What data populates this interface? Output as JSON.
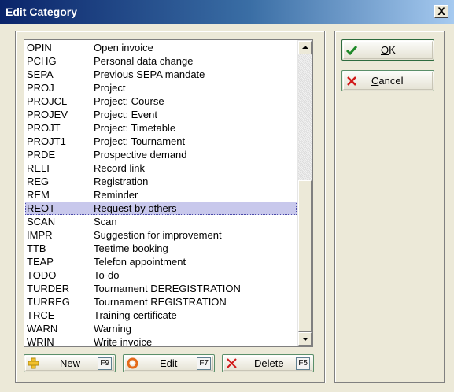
{
  "window": {
    "title": "Edit Category",
    "close_label": "X"
  },
  "list": {
    "selected_index": 12,
    "items": [
      {
        "code": "OPIN",
        "description": "Open invoice"
      },
      {
        "code": "PCHG",
        "description": "Personal data change"
      },
      {
        "code": "SEPA",
        "description": "Previous SEPA mandate"
      },
      {
        "code": "PROJ",
        "description": "Project"
      },
      {
        "code": "PROJCL",
        "description": "Project: Course"
      },
      {
        "code": "PROJEV",
        "description": "Project: Event"
      },
      {
        "code": "PROJT",
        "description": "Project: Timetable"
      },
      {
        "code": "PROJT1",
        "description": "Project: Tournament"
      },
      {
        "code": "PRDE",
        "description": "Prospective demand"
      },
      {
        "code": "RELI",
        "description": "Record link"
      },
      {
        "code": "REG",
        "description": "Registration"
      },
      {
        "code": "REM",
        "description": "Reminder"
      },
      {
        "code": "REOT",
        "description": "Request by others"
      },
      {
        "code": "SCAN",
        "description": "Scan"
      },
      {
        "code": "IMPR",
        "description": "Suggestion for improvement"
      },
      {
        "code": "TTB",
        "description": "Teetime booking"
      },
      {
        "code": "TEAP",
        "description": "Telefon appointment"
      },
      {
        "code": "TODO",
        "description": "To-do"
      },
      {
        "code": "TURDER",
        "description": "Tournament DEREGISTRATION"
      },
      {
        "code": "TURREG",
        "description": "Tournament REGISTRATION"
      },
      {
        "code": "TRCE",
        "description": "Training certificate"
      },
      {
        "code": "WARN",
        "description": "Warning"
      },
      {
        "code": "WRIN",
        "description": "Write invoice"
      }
    ]
  },
  "buttons": {
    "new": {
      "label": "New",
      "shortcut": "F9",
      "icon": "plus-icon"
    },
    "edit": {
      "label": "Edit",
      "shortcut": "F7",
      "icon": "edit-circle-icon"
    },
    "delete": {
      "label": "Delete",
      "shortcut": "F5",
      "icon": "x-icon"
    },
    "ok": {
      "label_first": "O",
      "label_rest": "K",
      "icon": "check-icon"
    },
    "cancel": {
      "label_first": "C",
      "label_rest": "ancel",
      "icon": "x-icon"
    }
  },
  "colors": {
    "selection": "#c8c8ec",
    "titlebar": "#0a246a",
    "check_green": "#1f8a2a",
    "x_red": "#d11a1a",
    "plus_yellow": "#f2c12e",
    "edit_orange": "#e46a1a"
  }
}
